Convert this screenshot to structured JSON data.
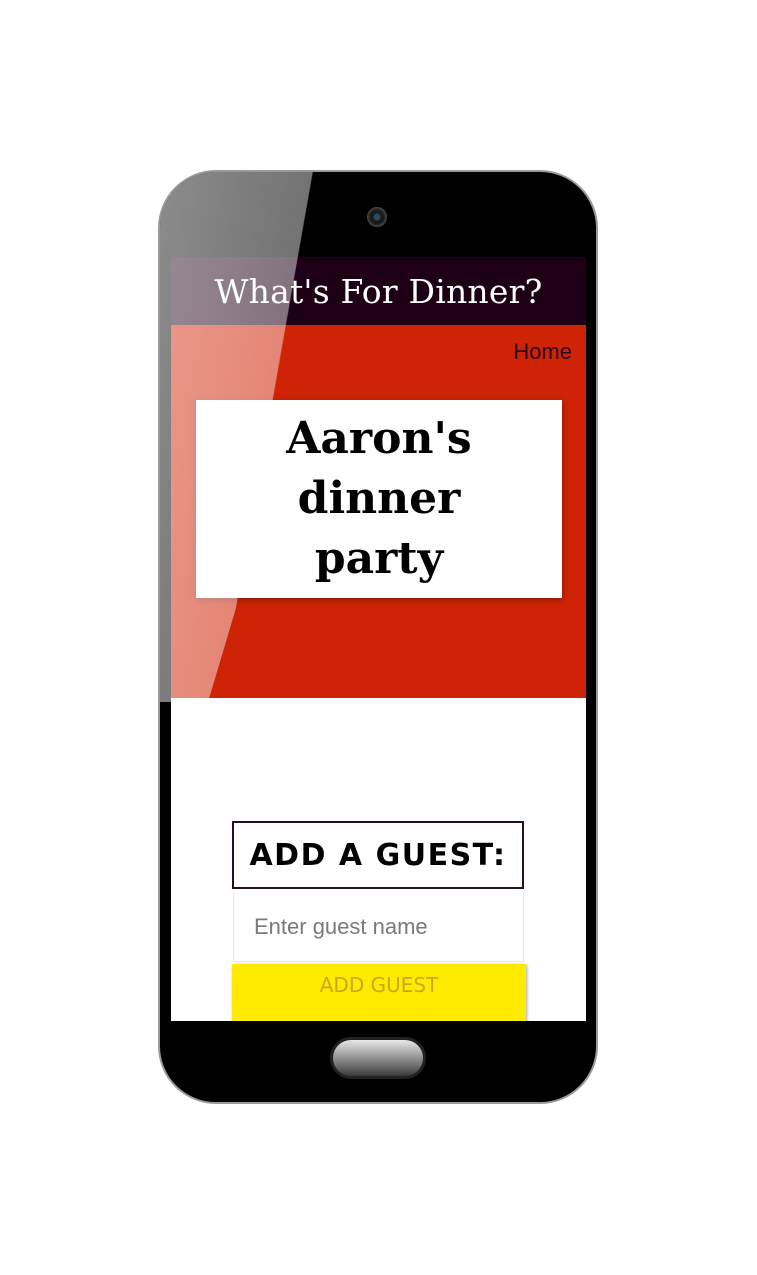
{
  "header": {
    "title": "What's For Dinner?"
  },
  "nav": {
    "home_label": "Home"
  },
  "hero": {
    "party_name": "Aaron's dinner party"
  },
  "guest_form": {
    "heading": "ADD A GUEST:",
    "input_placeholder": "Enter guest name",
    "input_value": "",
    "button_label": "ADD GUEST"
  },
  "colors": {
    "title_bar": "#1e0016",
    "hero_background": "#cf2305",
    "button_background": "#ffeb00",
    "button_text": "#c7aa1a"
  },
  "icons": {
    "camera": "camera-icon",
    "home_button": "hardware-home-button"
  }
}
